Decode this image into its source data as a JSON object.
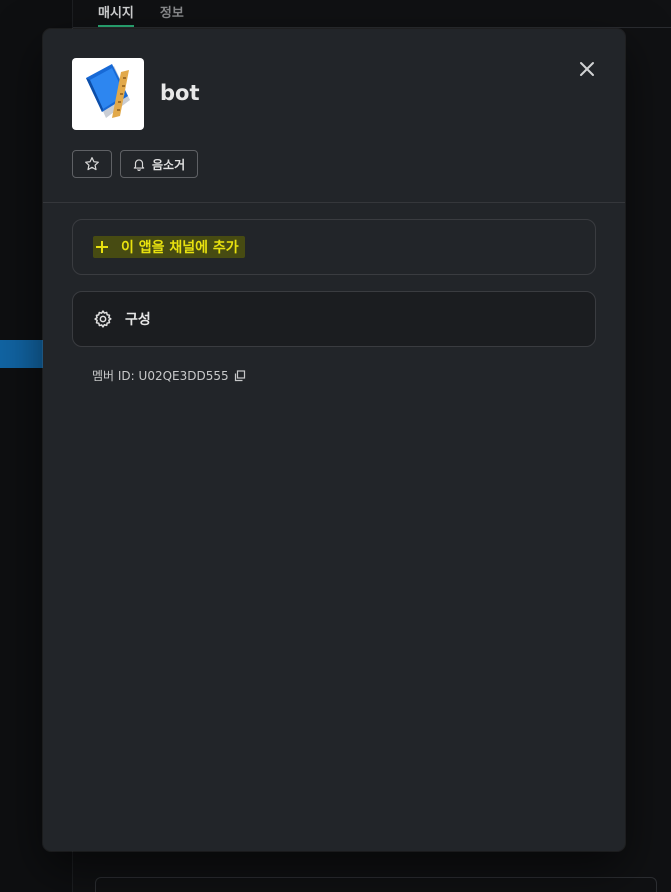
{
  "background": {
    "tabs": [
      {
        "label": "매시지",
        "active": true
      },
      {
        "label": "정보",
        "active": false
      }
    ]
  },
  "modal": {
    "app_name": "bot",
    "app_icon": "notebook-ruler-icon",
    "close_icon": "close-icon",
    "star_icon": "star-icon",
    "mute": {
      "icon": "bell-icon",
      "label": "음소거"
    },
    "add_to_channel": {
      "icon": "plus-icon",
      "label": "이 앱을 채널에 추가",
      "highlight_color": "#474b12"
    },
    "configure": {
      "icon": "gear-icon",
      "label": "구성"
    },
    "member_id": {
      "label": "멤버 ID: U02QE3DD555",
      "icon": "copy-icon"
    }
  },
  "colors": {
    "modal_bg": "#222529",
    "highlight_text": "#e8e10f",
    "tab_accent": "#2bac76",
    "selection": "#1164a3"
  }
}
